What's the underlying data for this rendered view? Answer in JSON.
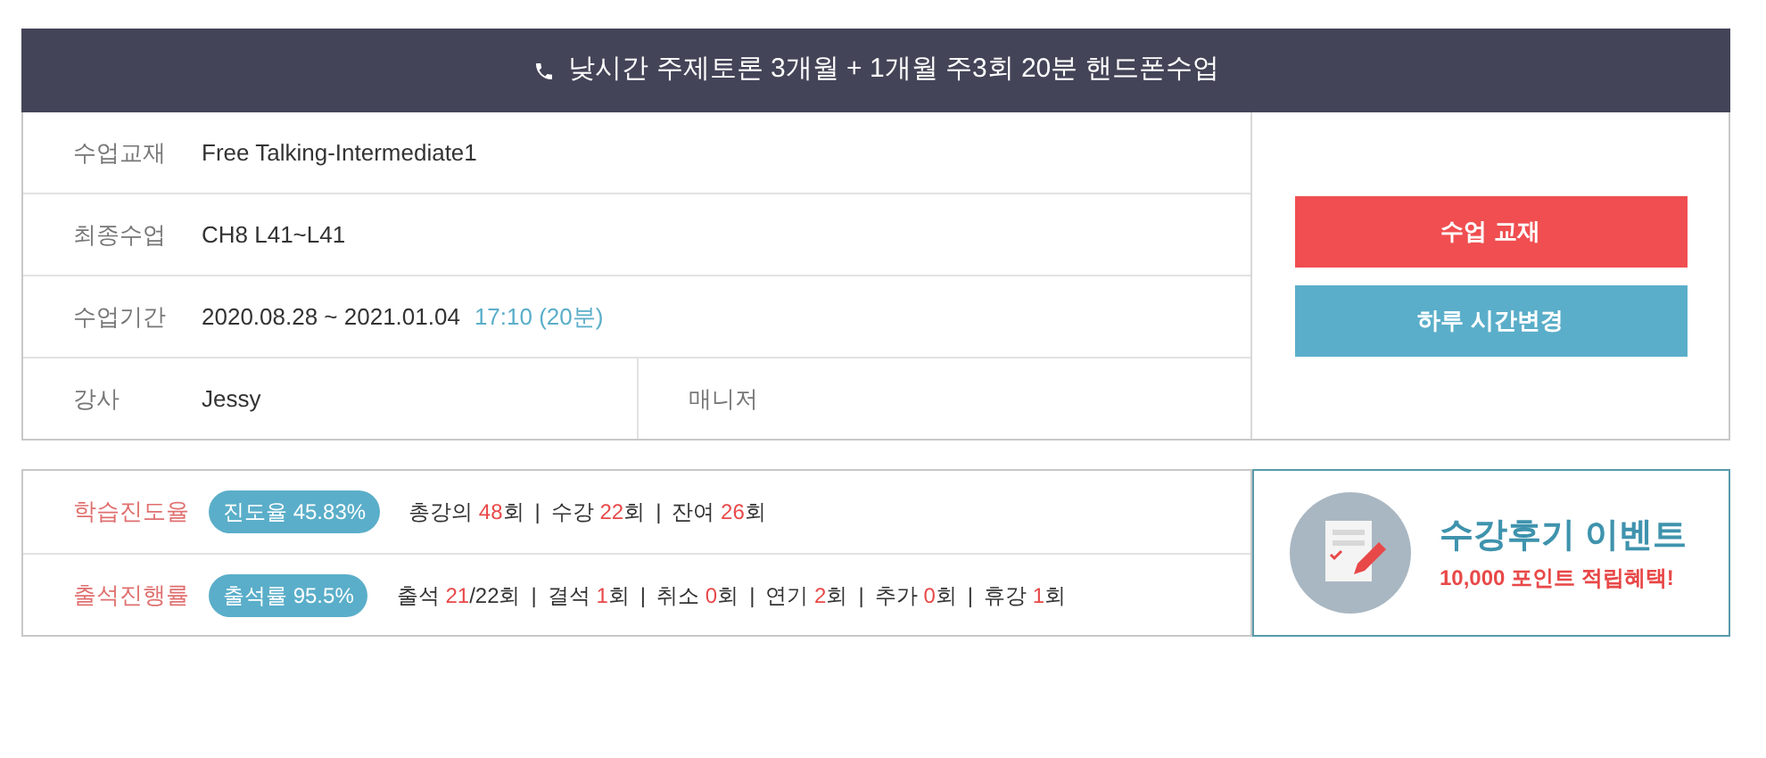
{
  "header": {
    "title": "낮시간 주제토론 3개월 + 1개월 주3회 20분 핸드폰수업"
  },
  "info_rows": [
    {
      "label": "수업교재",
      "value": "Free Talking-Intermediate1"
    },
    {
      "label": "최종수업",
      "value": "CH8 L41~L41"
    },
    {
      "label": "수업기간",
      "value": "2020.08.28 ~ 2021.01.04",
      "extra": "17:10 (20분)"
    }
  ],
  "teacher": {
    "label": "강사",
    "value": "Jessy",
    "manager_label": "매니저"
  },
  "buttons": [
    {
      "label": "수업 교재",
      "color": "#f04e50"
    },
    {
      "label": "하루 시간변경",
      "color": "#5aaec9"
    }
  ],
  "progress_rows": [
    {
      "label": "학습진도율",
      "badge": "진도율 45.83%",
      "separator": "|",
      "stats": [
        {
          "label": "총강의",
          "value": "48",
          "suffix": "회"
        },
        {
          "label": "수강",
          "value": "22",
          "suffix": "회"
        },
        {
          "label": "잔여",
          "value": "26",
          "suffix": "회"
        }
      ]
    },
    {
      "label": "출석진행률",
      "badge": "출석률 95.5%",
      "separator": "|",
      "stats": [
        {
          "label": "출석",
          "value": "21",
          "suffix": "/22회"
        },
        {
          "label": "결석",
          "value": "1",
          "suffix": "회"
        },
        {
          "label": "취소",
          "value": "0",
          "suffix": "회"
        },
        {
          "label": "연기",
          "value": "2",
          "suffix": "회"
        },
        {
          "label": "추가",
          "value": "0",
          "suffix": "회"
        },
        {
          "label": "휴강",
          "value": "1",
          "suffix": "회"
        }
      ]
    }
  ],
  "promo": {
    "title": "수강후기 이벤트",
    "subtitle": "10,000 포인트 적립혜택!"
  }
}
